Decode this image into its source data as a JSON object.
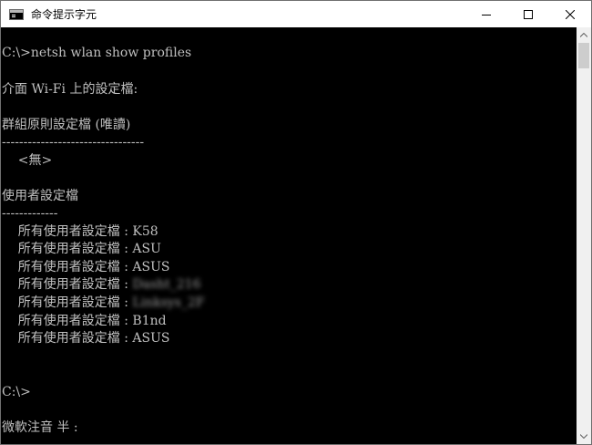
{
  "window": {
    "title": "命令提示字元",
    "icon": "cmd-icon",
    "controls": {
      "minimize_icon": "minimize-icon",
      "maximize_icon": "maximize-icon",
      "close_icon": "close-icon"
    }
  },
  "console": {
    "command_line": "C:\\>netsh wlan show profiles",
    "interface_header": "介面 Wi-Fi 上的設定檔:",
    "group_policy_header": "群組原則設定檔 (唯讀)",
    "group_policy_rule": "---------------------------------",
    "group_policy_none": "    <無>",
    "user_profiles_header": "使用者設定檔",
    "user_profiles_rule": "-------------",
    "profiles": [
      {
        "label": "    所有使用者設定檔 : ",
        "value": "K58"
      },
      {
        "label": "    所有使用者設定檔 : ",
        "value": "ASU"
      },
      {
        "label": "    所有使用者設定檔 : ",
        "value": "ASUS"
      },
      {
        "label": "    所有使用者設定檔 : ",
        "value": "Dasht_216"
      },
      {
        "label": "    所有使用者設定檔 : ",
        "value": "Linksys_2F"
      },
      {
        "label": "    所有使用者設定檔 : ",
        "value": "B1nd"
      },
      {
        "label": "    所有使用者設定檔 : ",
        "value": "ASUS"
      }
    ],
    "prompt": "C:\\>",
    "ime_status": "微軟注音 半 :"
  },
  "colors": {
    "console_background": "#000000",
    "console_text": "#c0c0c0",
    "titlebar_background": "#ffffff",
    "scrollbar_track": "#f0f0f0",
    "scrollbar_thumb": "#cdcdcd"
  }
}
